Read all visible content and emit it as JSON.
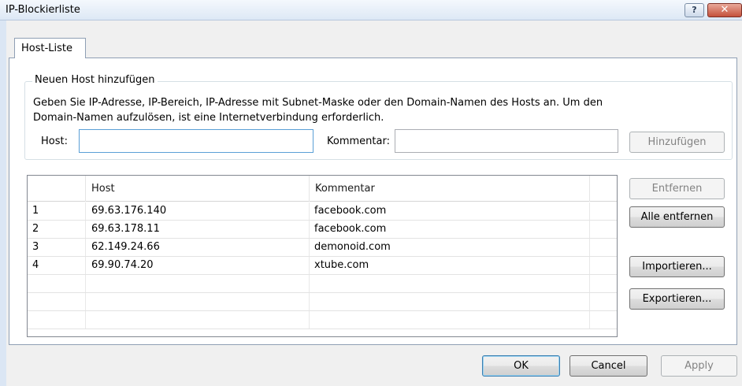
{
  "window": {
    "title": "IP-Blockierliste",
    "help_label": "?",
    "close_label": "✕"
  },
  "tabs": [
    {
      "label": "Host-Liste",
      "selected": true
    }
  ],
  "add_group": {
    "legend": "Neuen Host hinzufügen",
    "info_line1": "Geben Sie IP-Adresse, IP-Bereich, IP-Adresse mit Subnet-Maske oder den Domain-Namen des Hosts an. Um den",
    "info_line2": "Domain-Namen aufzulösen, ist eine Internetverbindung erforderlich.",
    "host_label": "Host:",
    "host_value": "",
    "comment_label": "Kommentar:",
    "comment_value": "",
    "add_button": "Hinzufügen"
  },
  "table": {
    "columns": [
      "",
      "Host",
      "Kommentar",
      ""
    ],
    "rows": [
      {
        "num": "1",
        "host": "69.63.176.140",
        "comment": "facebook.com"
      },
      {
        "num": "2",
        "host": "69.63.178.11",
        "comment": "facebook.com"
      },
      {
        "num": "3",
        "host": "62.149.24.66",
        "comment": "demonoid.com"
      },
      {
        "num": "4",
        "host": "69.90.74.20",
        "comment": "xtube.com"
      },
      {
        "num": "",
        "host": "",
        "comment": ""
      },
      {
        "num": "",
        "host": "",
        "comment": ""
      },
      {
        "num": "",
        "host": "",
        "comment": ""
      }
    ]
  },
  "side_buttons": {
    "remove": "Entfernen",
    "remove_all": "Alle entfernen",
    "import": "Importieren...",
    "export": "Exportieren..."
  },
  "footer": {
    "ok": "OK",
    "cancel": "Cancel",
    "apply": "Apply"
  },
  "colors": {
    "title_bar": "#dde8f5",
    "close_button": "#c4513c",
    "focus_border": "#5a9fd6"
  }
}
